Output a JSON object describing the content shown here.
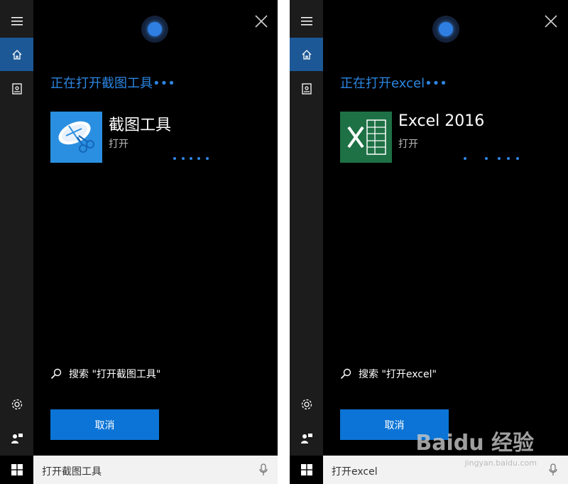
{
  "left": {
    "heading": "正在打开截图工具•••",
    "app_title": "截图工具",
    "app_subtitle": "打开",
    "search_hint": "搜索 \"打开截图工具\"",
    "cancel_label": "取消",
    "taskbar_input": "打开截图工具"
  },
  "right": {
    "heading": "正在打开excel•••",
    "app_title": "Excel 2016",
    "app_subtitle": "打开",
    "search_hint": "搜索 \"打开excel\"",
    "cancel_label": "取消",
    "taskbar_input": "打开excel"
  },
  "watermark": {
    "brand": "Baidu 经验",
    "site": "jingyan.baidu.com"
  },
  "colors": {
    "accent": "#2b86e2",
    "button": "#0b74d6",
    "rail_active": "#1d5896",
    "excel_green": "#1e7145",
    "snip_blue": "#2a8fe0"
  },
  "icons": [
    "hamburger-icon",
    "home-icon",
    "notebook-icon",
    "settings-gear-icon",
    "feedback-icon",
    "close-icon",
    "search-icon",
    "windows-start-icon",
    "microphone-icon",
    "snipping-tool-app-icon",
    "excel-app-icon",
    "cortana-icon"
  ]
}
